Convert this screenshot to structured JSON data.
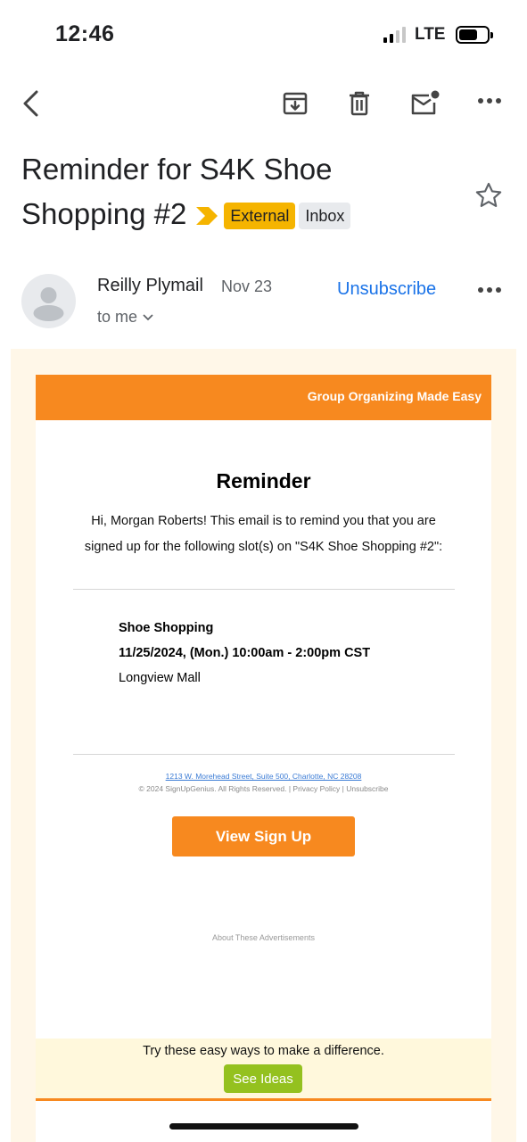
{
  "status_bar": {
    "time": "12:46",
    "network": "LTE"
  },
  "toolbar": {
    "back_icon": "back-arrow-icon",
    "archive_icon": "archive-icon",
    "delete_icon": "trash-icon",
    "unread_icon": "mark-unread-icon",
    "more_icon": "more-horizontal-icon"
  },
  "subject": {
    "line1": "Reminder for S4K Shoe",
    "line2": "Shopping #2",
    "label_external": "External",
    "label_inbox": "Inbox"
  },
  "sender": {
    "name": "Reilly Plymail",
    "date": "Nov 23",
    "to": "to me",
    "unsubscribe": "Unsubscribe"
  },
  "email": {
    "tagline": "Group Organizing Made Easy",
    "heading": "Reminder",
    "intro_line1": "Hi, Morgan Roberts! This email is to remind you that you are",
    "intro_line2": "signed up for the following slot(s) on \"S4K Shoe Shopping #2\":",
    "slot_title": "Shoe Shopping",
    "slot_time": "11/25/2024, (Mon.) 10:00am - 2:00pm CST",
    "slot_location": "Longview Mall",
    "button_label": "View Sign Up",
    "ads_label": "About These Advertisements",
    "try_text": "Try these easy ways to make a difference.",
    "see_ideas": "See Ideas",
    "footer_address": "1213 W. Morehead Street, Suite 500, Charlotte, NC 28208",
    "footer_copy": "© 2024 SignUpGenius. All Rights Reserved. | Privacy Policy | Unsubscribe"
  },
  "colors": {
    "accent_orange": "#f7891f",
    "external_label": "#f5b400",
    "link_blue": "#1a73e8",
    "ideas_green": "#94c11f"
  }
}
